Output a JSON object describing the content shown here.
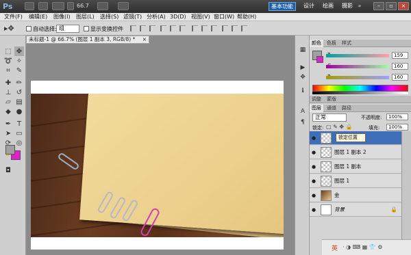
{
  "app": {
    "logo": "Ps",
    "zoom": "66.7"
  },
  "workspaces": {
    "basic": "基本功能",
    "design": "设计",
    "paint": "绘画",
    "photo": "摄影",
    "more": "»"
  },
  "window_controls": {
    "minimize": "–",
    "restore": "▫",
    "close": "×"
  },
  "menu": [
    "文件(F)",
    "编辑(E)",
    "图像(I)",
    "图层(L)",
    "选择(S)",
    "滤镜(T)",
    "分析(A)",
    "3D(D)",
    "视图(V)",
    "窗口(W)",
    "帮助(H)"
  ],
  "options": {
    "auto_select_label": "自动选择:",
    "auto_select_value": "组",
    "show_transform_label": "显示变换控件"
  },
  "document": {
    "tab_title": "未标题-1 @ 66.7% (图层 1 副本 3, RGB/8) *",
    "close": "×"
  },
  "color_panel": {
    "tabs": [
      "颜色",
      "色板",
      "样式"
    ],
    "active_tab": 0,
    "r_label": "R",
    "g_label": "G",
    "b_label": "B",
    "r": "159",
    "g": "160",
    "b": "160"
  },
  "adjust_tabs": [
    "调整",
    "蒙版"
  ],
  "layers_panel": {
    "tabs": [
      "图层",
      "通道",
      "路径"
    ],
    "blend_mode": "正常",
    "opacity_label": "不透明度:",
    "opacity": "100%",
    "lock_label": "锁定:",
    "fill_label": "填充:",
    "fill": "100%",
    "tooltip": "锁定位置",
    "layers": [
      {
        "name": "",
        "selected": true
      },
      {
        "name": "图层 1 副本 2",
        "selected": false
      },
      {
        "name": "图层 1 副本",
        "selected": false
      },
      {
        "name": "图层 1",
        "selected": false
      },
      {
        "name": "金",
        "selected": false
      },
      {
        "name": "背景",
        "selected": false
      }
    ]
  },
  "tray": {
    "ime": "英",
    "icons": "·  ◑  ⌨  ▦  👕  ⚙"
  },
  "colors": {
    "accent": "#3d6fb9",
    "foreground": "#9fa0a0",
    "background": "#e020c8"
  }
}
